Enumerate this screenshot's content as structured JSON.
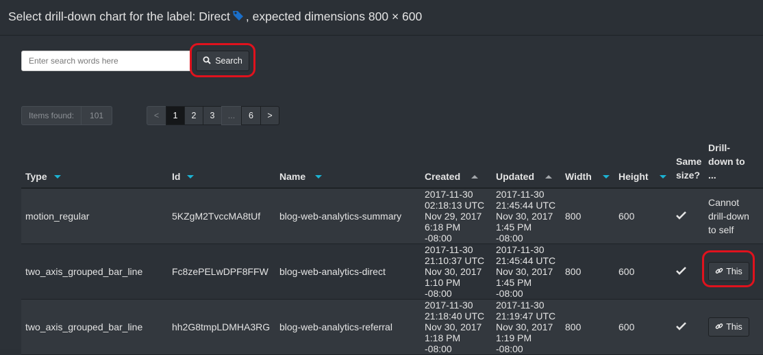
{
  "header": {
    "prefix": "Select drill-down chart for the label:",
    "label": "Direct",
    "suffix": ", expected dimensions 800 × 600",
    "tag_icon": "tag-icon",
    "tag_color": "#1b6fc9"
  },
  "search": {
    "placeholder": "Enter search words here",
    "value": "",
    "button_label": "Search"
  },
  "items_found": {
    "label": "Items found:",
    "count": "101"
  },
  "pagination": {
    "prev": "<",
    "pages": [
      "1",
      "2",
      "3",
      "...",
      "6"
    ],
    "next": ">",
    "active": "1"
  },
  "columns": {
    "type": "Type",
    "id": "Id",
    "name": "Name",
    "created": "Created",
    "updated": "Updated",
    "width": "Width",
    "height": "Height",
    "same_size_1": "Same",
    "same_size_2": "size?",
    "drill_1": "Drill-",
    "drill_2": "down to",
    "drill_3": "..."
  },
  "rows": [
    {
      "type": "motion_regular",
      "id": "5KZgM2TvccMA8tUf",
      "name": "blog-web-analytics-summary",
      "created": [
        "2017-11-30",
        "02:18:13 UTC",
        "Nov 29, 2017",
        "6:18 PM -08:00"
      ],
      "updated": [
        "2017-11-30",
        "21:45:44 UTC",
        "Nov 30, 2017",
        "1:45 PM -08:00"
      ],
      "width": "800",
      "height": "600",
      "drill_text": [
        "Cannot",
        "drill-down",
        "to self"
      ]
    },
    {
      "type": "two_axis_grouped_bar_line",
      "id": "Fc8zePELwDPF8FFW",
      "name": "blog-web-analytics-direct",
      "created": [
        "2017-11-30",
        "21:10:37 UTC",
        "Nov 30, 2017",
        "1:10 PM -08:00"
      ],
      "updated": [
        "2017-11-30",
        "21:45:44 UTC",
        "Nov 30, 2017",
        "1:45 PM -08:00"
      ],
      "width": "800",
      "height": "600",
      "button": "This"
    },
    {
      "type": "two_axis_grouped_bar_line",
      "id": "hh2G8tmpLDMHA3RG",
      "name": "blog-web-analytics-referral",
      "created": [
        "2017-11-30",
        "21:18:40 UTC",
        "Nov 30, 2017",
        "1:18 PM -08:00"
      ],
      "updated": [
        "2017-11-30",
        "21:19:47 UTC",
        "Nov 30, 2017",
        "1:19 PM -08:00"
      ],
      "width": "800",
      "height": "600",
      "button": "This"
    }
  ]
}
